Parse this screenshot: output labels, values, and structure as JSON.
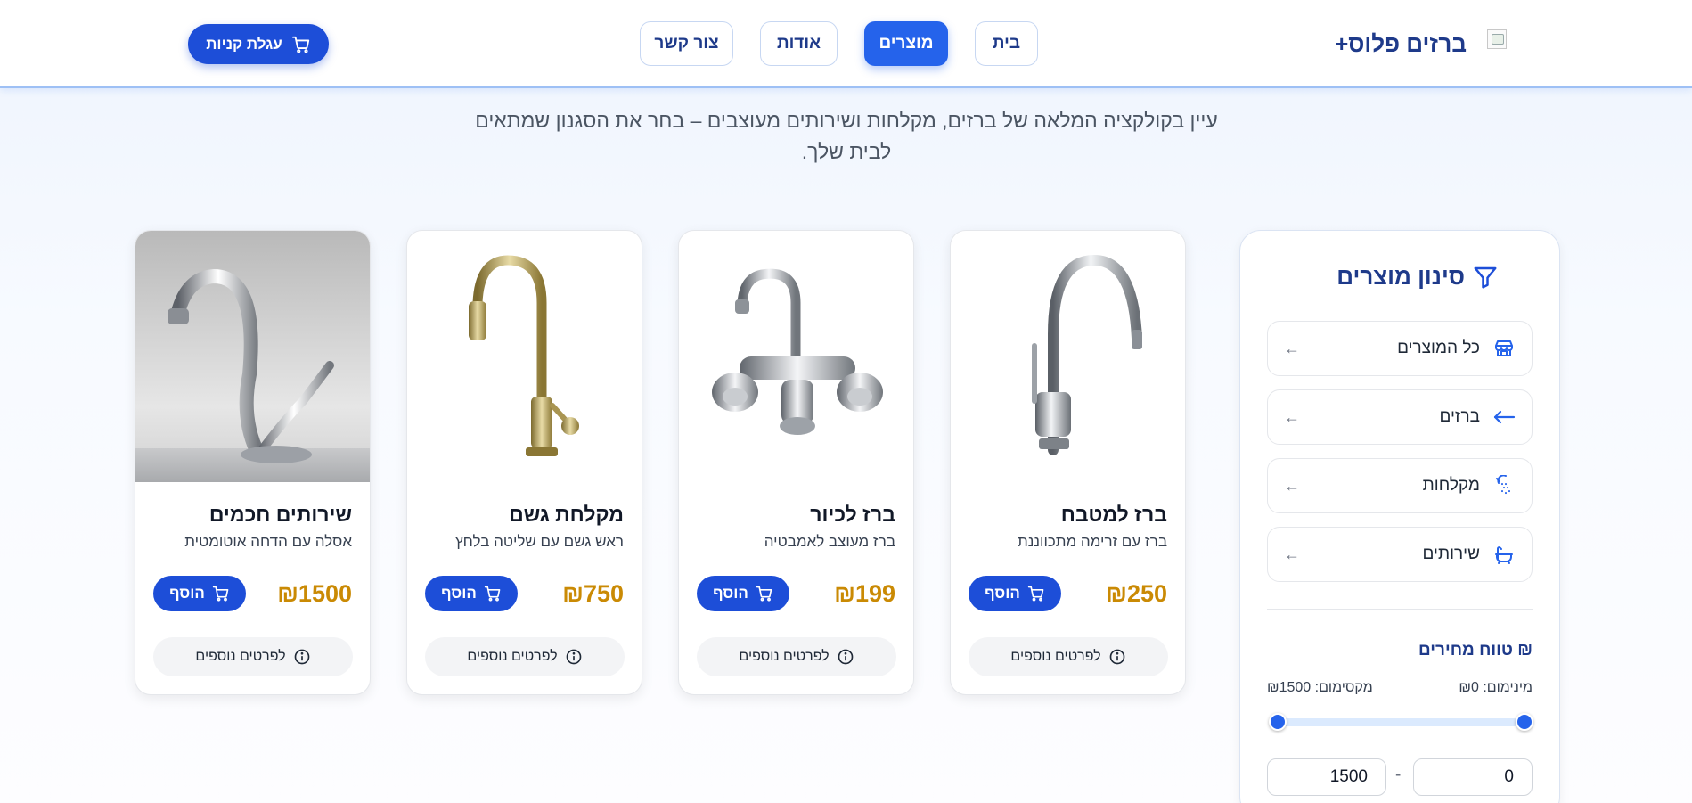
{
  "header": {
    "brand": "ברזים פלוס+",
    "nav": [
      {
        "label": "בית",
        "active": false
      },
      {
        "label": "מוצרים",
        "active": true
      },
      {
        "label": "אודות",
        "active": false
      },
      {
        "label": "צור קשר",
        "active": false
      }
    ],
    "cart_label": "עגלת קניות"
  },
  "intro_text": "עיין בקולקציה המלאה של ברזים, מקלחות ושירותים מעוצבים – בחר את הסגנון שמתאים לבית שלך.",
  "products": [
    {
      "name": "ברז למטבח",
      "desc": "ברז עם זרימה מתכווננת",
      "price": "₪250",
      "add_label": "הוסף",
      "more_label": "לפרטים נוספים"
    },
    {
      "name": "ברז לכיור",
      "desc": "ברז מעוצב לאמבטיה",
      "price": "₪199",
      "add_label": "הוסף",
      "more_label": "לפרטים נוספים"
    },
    {
      "name": "מקלחת גשם",
      "desc": "ראש גשם עם שליטה בלחץ",
      "price": "₪750",
      "add_label": "הוסף",
      "more_label": "לפרטים נוספים"
    },
    {
      "name": "שירותים חכמים",
      "desc": "אסלה עם הדחה אוטומטית",
      "price": "₪1500",
      "add_label": "הוסף",
      "more_label": "לפרטים נוספים"
    }
  ],
  "sidebar": {
    "title": "סינון מוצרים",
    "categories": [
      {
        "label": "כל המוצרים",
        "icon": "store-icon"
      },
      {
        "label": "ברזים",
        "icon": "arrow-left-icon"
      },
      {
        "label": "מקלחות",
        "icon": "shower-icon"
      },
      {
        "label": "שירותים",
        "icon": "bath-icon"
      }
    ],
    "price_title": "₪ טווח מחירים",
    "min_label": "מינימום: ₪0",
    "max_label": "מקסימום: ₪1500",
    "range": {
      "min": 0,
      "max": 1500,
      "low": 0,
      "high": 1500
    },
    "min_value": "0",
    "max_value": "1500"
  },
  "colors": {
    "primary": "#1d4ed8",
    "accent": "#2563eb",
    "price": "#ca8a04",
    "brand": "#1e3a8a"
  }
}
